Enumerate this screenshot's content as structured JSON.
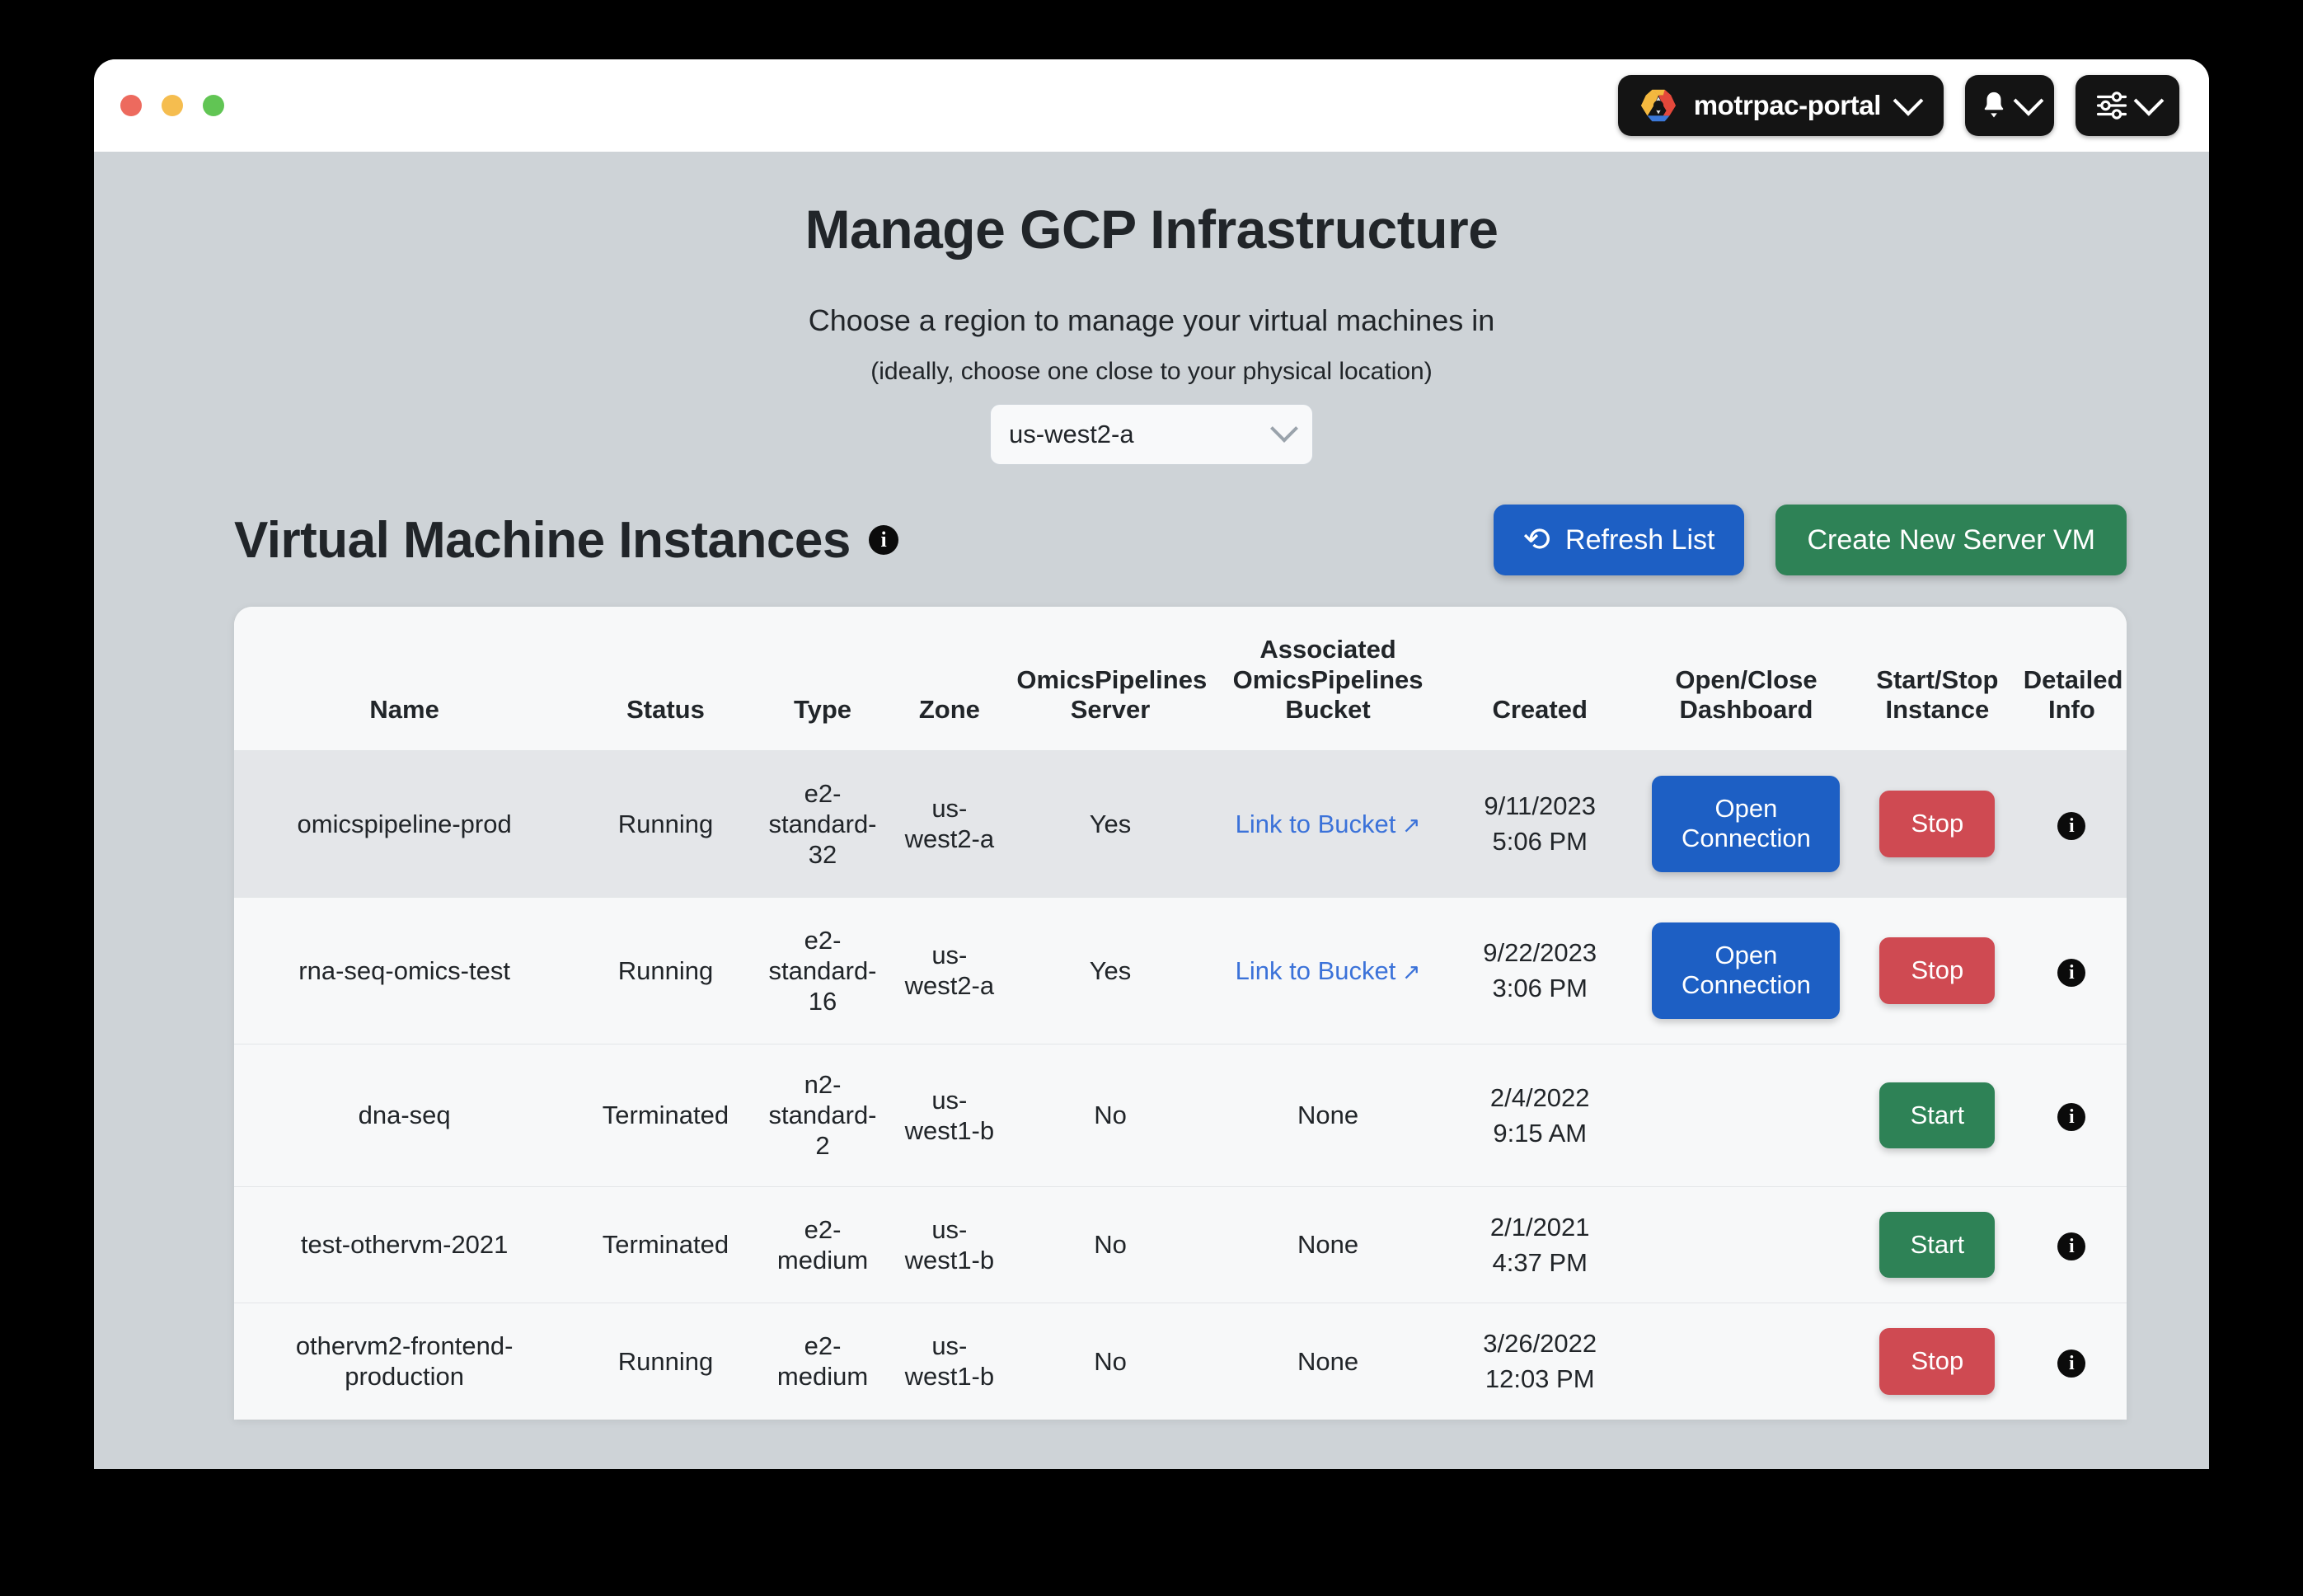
{
  "window": {
    "traffic_lights": [
      "close",
      "minimize",
      "maximize"
    ]
  },
  "topbar": {
    "project_button": {
      "label": "motrpac-portal",
      "icon": "google-cloud-logo-icon",
      "chevron": "chevron-down-icon"
    },
    "notifications_button": {
      "icon": "bell-icon",
      "chevron": "chevron-down-icon"
    },
    "settings_button": {
      "icon": "sliders-icon",
      "chevron": "chevron-down-icon"
    }
  },
  "hero": {
    "title": "Manage GCP Infrastructure",
    "subtitle": "Choose a region to manage your virtual machines in",
    "subtitle_note": "(ideally, choose one close to your physical location)",
    "region_select": {
      "value": "us-west2-a",
      "chevron": "chevron-down-icon"
    }
  },
  "section": {
    "title": "Virtual Machine Instances",
    "info_icon": "info-icon",
    "refresh_button": {
      "label": "Refresh List",
      "icon": "refresh-icon",
      "color": "#1d5fc4"
    },
    "create_button": {
      "label": "Create New Server VM",
      "color": "#2e8256"
    }
  },
  "table": {
    "columns": [
      {
        "line1": "",
        "line2": "",
        "line3": "Name"
      },
      {
        "line1": "",
        "line2": "",
        "line3": "Status"
      },
      {
        "line1": "",
        "line2": "",
        "line3": "Type"
      },
      {
        "line1": "",
        "line2": "",
        "line3": "Zone"
      },
      {
        "line1": "",
        "line2": "OmicsPipelines",
        "line3": "Server"
      },
      {
        "line1": "Associated",
        "line2": "OmicsPipelines",
        "line3": "Bucket"
      },
      {
        "line1": "",
        "line2": "",
        "line3": "Created"
      },
      {
        "line1": "",
        "line2": "Open/Close",
        "line3": "Dashboard"
      },
      {
        "line1": "",
        "line2": "Start/Stop",
        "line3": "Instance"
      },
      {
        "line1": "",
        "line2": "Detailed",
        "line3": "Info"
      }
    ],
    "rows": [
      {
        "name": "omicspipeline-prod",
        "status": "Running",
        "type": "e2-standard-32",
        "zone": "us-west2-a",
        "omics_server": "Yes",
        "bucket": "Link to Bucket",
        "bucket_is_link": true,
        "created_date": "9/11/2023",
        "created_time": "5:06 PM",
        "dashboard_action": "Open Connection",
        "power_action": "Stop",
        "info_icon": "info-icon"
      },
      {
        "name": "rna-seq-omics-test",
        "status": "Running",
        "type": "e2-standard-16",
        "zone": "us-west2-a",
        "omics_server": "Yes",
        "bucket": "Link to Bucket",
        "bucket_is_link": true,
        "created_date": "9/22/2023",
        "created_time": "3:06 PM",
        "dashboard_action": "Open Connection",
        "power_action": "Stop",
        "info_icon": "info-icon"
      },
      {
        "name": "dna-seq",
        "status": "Terminated",
        "type": "n2-standard-2",
        "zone": "us-west1-b",
        "omics_server": "No",
        "bucket": "None",
        "bucket_is_link": false,
        "created_date": "2/4/2022",
        "created_time": "9:15 AM",
        "dashboard_action": "",
        "power_action": "Start",
        "info_icon": "info-icon"
      },
      {
        "name": "test-othervm-2021",
        "status": "Terminated",
        "type": "e2-medium",
        "zone": "us-west1-b",
        "omics_server": "No",
        "bucket": "None",
        "bucket_is_link": false,
        "created_date": "2/1/2021",
        "created_time": "4:37 PM",
        "dashboard_action": "",
        "power_action": "Start",
        "info_icon": "info-icon"
      },
      {
        "name": "othervm2-frontend-production",
        "status": "Running",
        "type": "e2-medium",
        "zone": "us-west1-b",
        "omics_server": "No",
        "bucket": "None",
        "bucket_is_link": false,
        "created_date": "3/26/2022",
        "created_time": "12:03 PM",
        "dashboard_action": "",
        "power_action": "Stop",
        "info_icon": "info-icon"
      }
    ]
  },
  "colors": {
    "page_background": "#ced3d7",
    "card_background": "#f7f8f9",
    "row_alt_background": "#e4e6e9",
    "primary_blue": "#1d5fc4",
    "success_green": "#2e8256",
    "danger_red": "#cf4a52",
    "link_blue": "#3b72d9",
    "topbar_pill": "#141414"
  }
}
